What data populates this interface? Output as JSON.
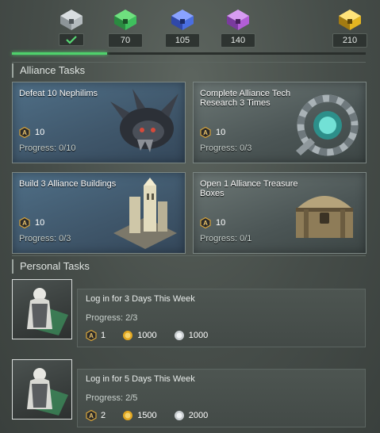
{
  "milestones": [
    {
      "value": "",
      "claimed": true,
      "color": "#b8c0c3"
    },
    {
      "value": "70",
      "claimed": false,
      "color": "#3fbf5d"
    },
    {
      "value": "105",
      "claimed": false,
      "color": "#4a6ee0"
    },
    {
      "value": "140",
      "claimed": false,
      "color": "#b25ed6"
    },
    {
      "value": "210",
      "claimed": false,
      "color": "#e3b521"
    }
  ],
  "progress_fraction": 0.27,
  "alliance": {
    "title": "Alliance Tasks",
    "tasks": [
      {
        "title": "Defeat 10 Nephilims",
        "reward": "10",
        "progress": "Progress: 0/10"
      },
      {
        "title": "Complete Alliance Tech Research 3 Times",
        "reward": "10",
        "progress": "Progress: 0/3"
      },
      {
        "title": "Build 3 Alliance Buildings",
        "reward": "10",
        "progress": "Progress: 0/3"
      },
      {
        "title": "Open 1 Alliance Treasure Boxes",
        "reward": "10",
        "progress": "Progress: 0/1"
      }
    ]
  },
  "personal": {
    "title": "Personal Tasks",
    "tasks": [
      {
        "title": "Log in for 3 Days This Week",
        "progress": "Progress: 2/3",
        "rewards": [
          "1",
          "1000",
          "1000"
        ]
      },
      {
        "title": "Log in for 5 Days This Week",
        "progress": "Progress: 2/5",
        "rewards": [
          "2",
          "1500",
          "2000"
        ]
      }
    ]
  },
  "colors": {
    "accent": "#4fd16c",
    "card_blue": "#4f6f87",
    "card_gray": "#5f6a68"
  },
  "icons": [
    "chest-icon",
    "checkmark-icon",
    "alliance-point-icon",
    "gold-coin-icon",
    "silver-coin-icon",
    "nephilim-monster-icon",
    "tech-gear-icon",
    "alliance-building-icon",
    "treasure-box-icon",
    "commander-avatar-icon"
  ]
}
